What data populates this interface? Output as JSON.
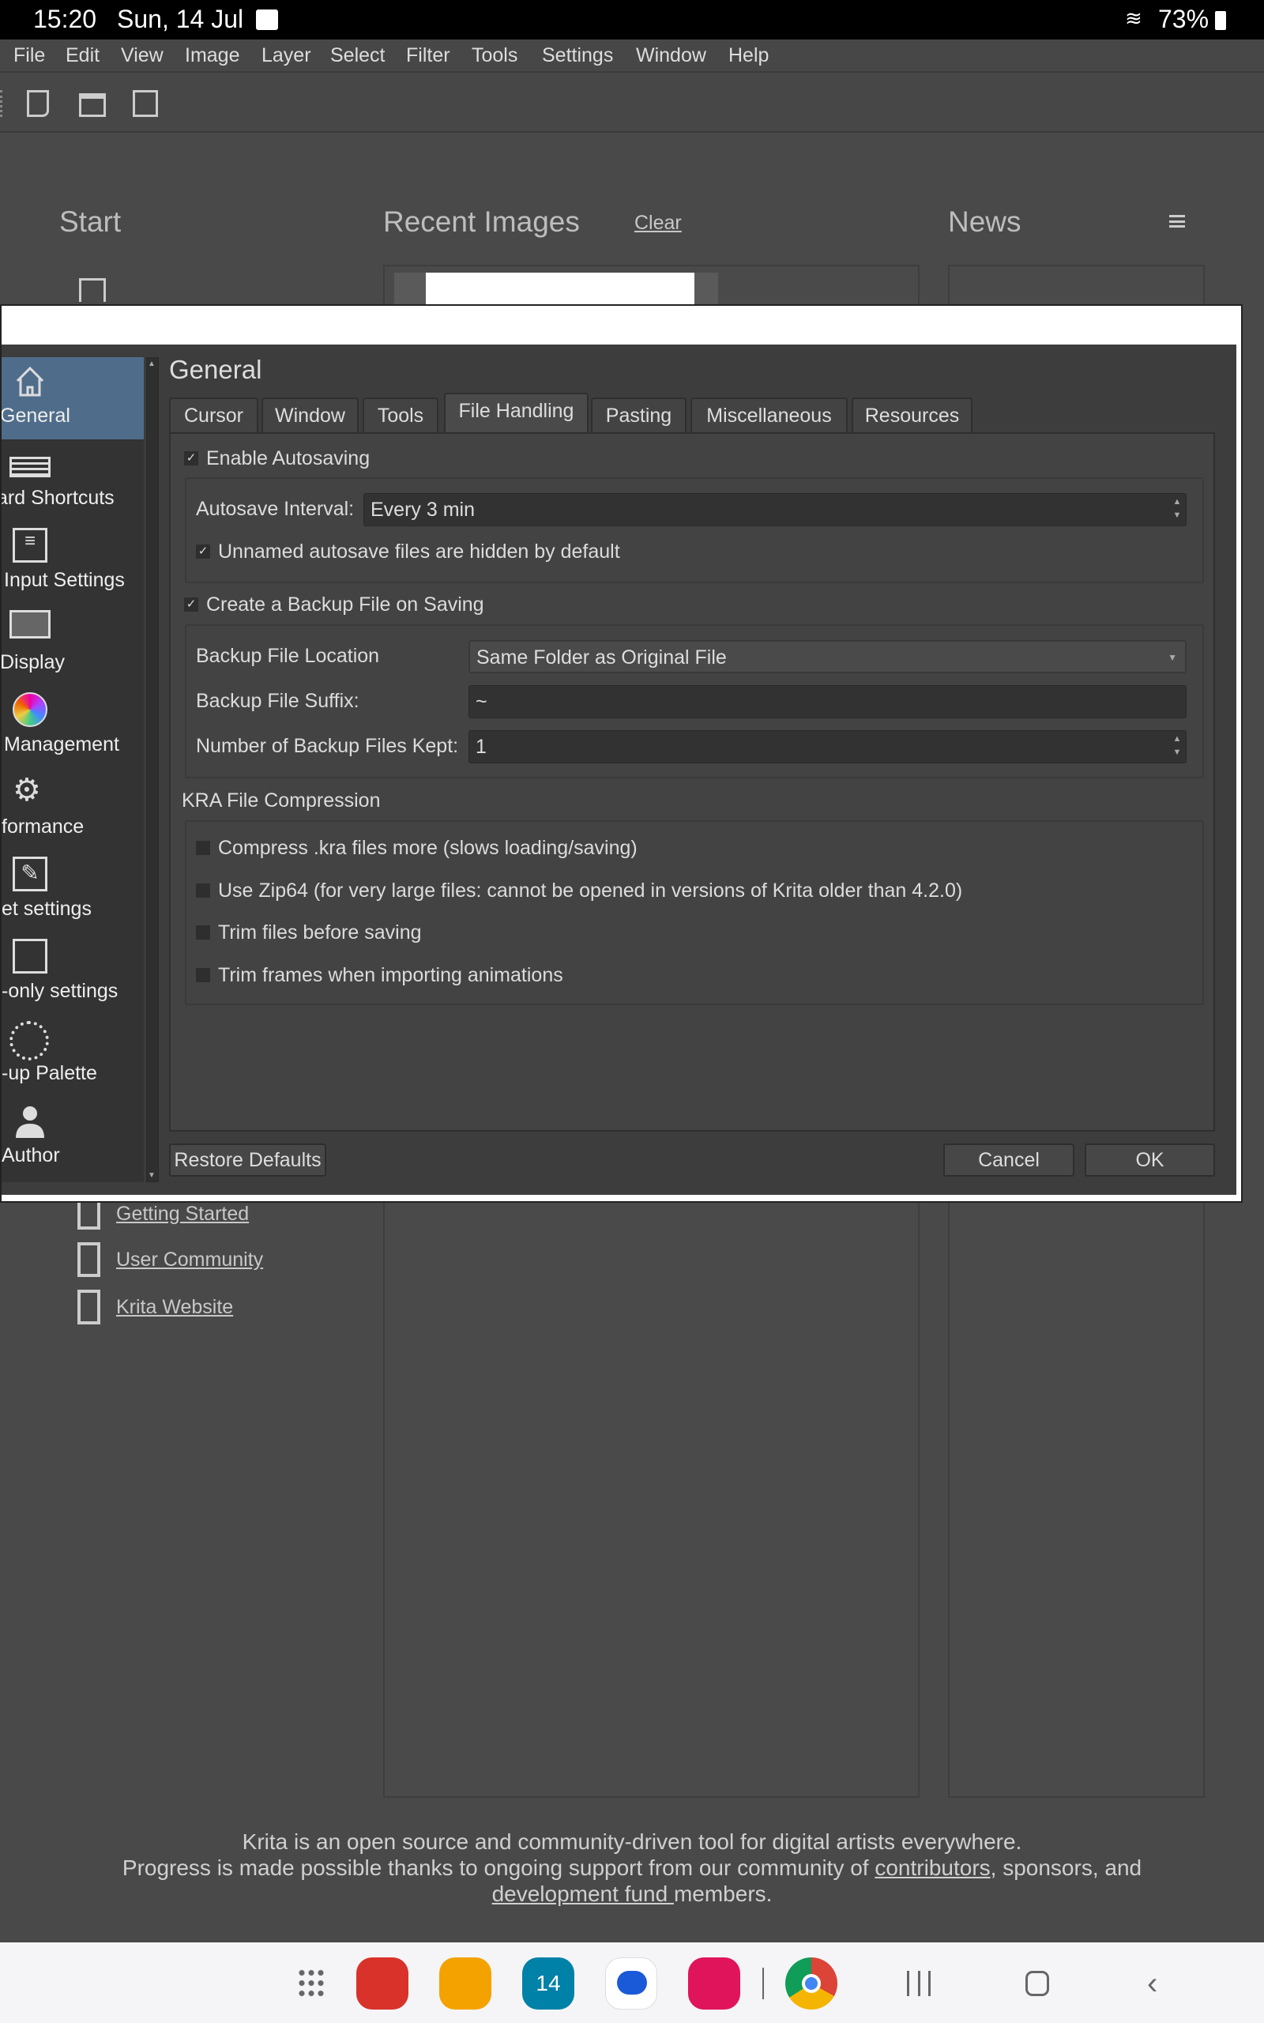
{
  "status_bar": {
    "time": "15:20",
    "date": "Sun, 14 Jul",
    "battery": "73%"
  },
  "menu": [
    "File",
    "Edit",
    "View",
    "Image",
    "Layer",
    "Select",
    "Filter",
    "Tools",
    "Settings",
    "Window",
    "Help"
  ],
  "toolbar": {
    "icons": [
      "new-document-icon",
      "open-folder-icon",
      "save-icon"
    ]
  },
  "welcome": {
    "start": "Start",
    "recent": "Recent Images",
    "clear": "Clear",
    "news": "News",
    "links": [
      "Getting Started",
      "User Community",
      "Krita Website"
    ],
    "footer_line1": "Krita is an open source and community-driven tool for digital artists everywhere.",
    "footer_line2_a": "Progress is made possible thanks to ongoing support from our community of ",
    "footer_contributors": "contributors",
    "footer_line2_b": ", sponsors, and",
    "footer_fund": "development fund ",
    "footer_members": "members."
  },
  "dialog": {
    "sidebar": [
      "General",
      "ard Shortcuts",
      "Input Settings",
      "Display",
      "Management",
      "formance",
      "et settings",
      "-only settings",
      "-up Palette",
      "Author"
    ],
    "title": "General",
    "tabs": [
      "Cursor",
      "Window",
      "Tools",
      "File Handling",
      "Pasting",
      "Miscellaneous",
      "Resources"
    ],
    "active_tab": "File Handling",
    "enable_autosaving": "Enable Autosaving",
    "autosave_interval_label": "Autosave Interval:",
    "autosave_interval_value": "Every 3 min",
    "unnamed_hidden": "Unnamed autosave files are hidden by default",
    "create_backup": "Create a Backup File on Saving",
    "backup_location_label": "Backup File Location",
    "backup_location_value": "Same Folder as Original File",
    "backup_suffix_label": "Backup File Suffix:",
    "backup_suffix_value": "~",
    "backup_count_label": "Number of Backup Files Kept:",
    "backup_count_value": "1",
    "kra_heading": "KRA File Compression",
    "kra_options": [
      "Compress .kra files more (slows loading/saving)",
      "Use Zip64 (for very large files: cannot be opened in versions of Krita older than 4.2.0)",
      "Trim files before saving",
      "Trim frames when importing animations"
    ],
    "restore_defaults": "Restore Defaults",
    "cancel": "Cancel",
    "ok": "OK"
  },
  "navbar": {
    "calendar_day": "14"
  }
}
